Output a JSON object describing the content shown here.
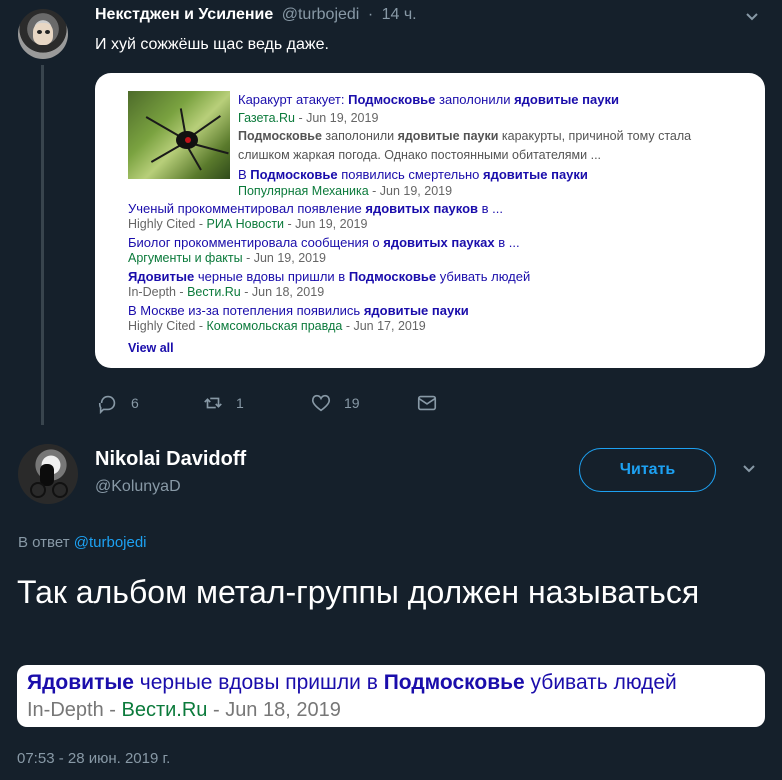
{
  "tweet1": {
    "name": "Некстджен и Усиление",
    "handle": "@turbojedi",
    "time": "14 ч.",
    "text": "И хуй сожжёшь щас ведь даже.",
    "card": {
      "items": [
        {
          "headline_parts": [
            "Каракурт атакует: ",
            "Подмосковье",
            " заполонили ",
            "ядовитые пауки"
          ],
          "bold_flags": [
            false,
            true,
            false,
            true
          ],
          "meta_prefix": "",
          "source": "Газета.Ru",
          "date": "Jun 19, 2019",
          "snippet_parts": [
            "Подмосковье",
            " заполонили ",
            "ядовитые пауки",
            " каракурты, причиной тому стала слишком жаркая погода. Однако постоянными обитателями ..."
          ]
        },
        {
          "headline_parts": [
            "В ",
            "Подмосковье",
            " появились смертельно ",
            "ядовитые пауки"
          ],
          "meta_prefix": "",
          "source": "Популярная Механика",
          "date": "Jun 19, 2019"
        },
        {
          "headline_parts": [
            "Ученый прокомментировал появление ",
            "ядовитых пауков",
            " в ..."
          ],
          "meta_prefix": "Highly Cited - ",
          "source": "РИА Новости",
          "date": "Jun 19, 2019"
        },
        {
          "headline_parts": [
            "Биолог прокомментировала сообщения о ",
            "ядовитых пауках",
            " в ..."
          ],
          "meta_prefix": "",
          "source": "Аргументы и факты",
          "date": "Jun 19, 2019"
        },
        {
          "headline_parts": [
            "Ядовитые",
            " черные вдовы пришли в ",
            "Подмосковье",
            " убивать людей"
          ],
          "meta_prefix": "In-Depth - ",
          "source": "Вести.Ru",
          "date": "Jun 18, 2019"
        },
        {
          "headline_parts": [
            "В Москве из-за потепления появились ",
            "ядовитые пауки"
          ],
          "meta_prefix": "Highly Cited - ",
          "source": "Комсомольская правда",
          "date": "Jun 17, 2019"
        }
      ],
      "view_all": "View all",
      "separator": " - "
    },
    "actions": {
      "replies": "6",
      "retweets": "1",
      "likes": "19"
    },
    "icons": [
      "reply-icon",
      "retweet-icon",
      "like-icon",
      "dm-icon",
      "chevron-down-icon"
    ]
  },
  "tweet2": {
    "name": "Nikolai Davidoff",
    "handle": "@KolunyaD",
    "follow_label": "Читать",
    "reply_prefix": "В ответ ",
    "reply_handle": "@turbojedi",
    "text": "Так альбом метал-группы должен называться",
    "crop": {
      "line1_parts": [
        "Ядовитые",
        " черные вдовы пришли в ",
        "Подмосковье",
        " убивать людей"
      ],
      "meta_prefix": "In-Depth - ",
      "source": "Вести.Ru",
      "date": "Jun 18, 2019"
    },
    "timestamp": "07:53 - 28 июн. 2019 г."
  },
  "colors": {
    "background": "#15202b",
    "accent": "#1da1f2",
    "muted": "#8899a6",
    "link": "#1a0dab",
    "source_green": "#0b7a3b"
  }
}
